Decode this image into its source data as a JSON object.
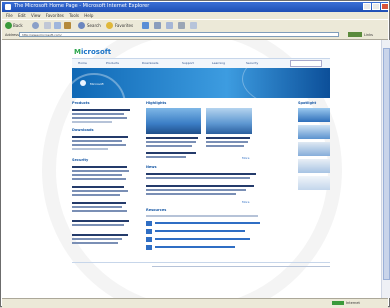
{
  "window": {
    "title": "The Microsoft Home Page - Microsoft Internet Explorer"
  },
  "menu": [
    "File",
    "Edit",
    "View",
    "Favorites",
    "Tools",
    "Help"
  ],
  "toolbar": {
    "back_label": "Back",
    "search_label": "Search",
    "favorites_label": "Favorites"
  },
  "address": {
    "label": "Address",
    "url": "http://www.microsoft.com/",
    "go_label": "Go",
    "links_label": "Links"
  },
  "site": {
    "logo": "Microsoft",
    "nav": [
      "Home",
      "Products",
      "Downloads",
      "Support",
      "Learning",
      "Security"
    ],
    "hero_tag": "Microsoft",
    "col_left_heading": "Products",
    "col_left_h2": "Downloads",
    "col_left_h3": "Security",
    "col_mid_heading": "Highlights",
    "col_mid_h2": "News",
    "col_mid_h3": "Resources",
    "col_right_heading": "Spotlight",
    "more_label": "More"
  },
  "status": {
    "zone": "Internet"
  },
  "colors": {
    "accent": "#1a73c7",
    "hero": "#0f68b5",
    "link": "#2f6ec4"
  }
}
